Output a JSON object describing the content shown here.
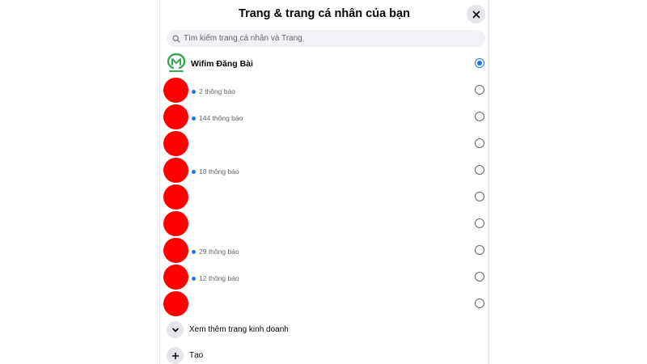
{
  "dialog": {
    "title": "Trang & trang cá nhân của bạn"
  },
  "search": {
    "placeholder": "Tìm kiếm trang cá nhân và Trang"
  },
  "profiles": [
    {
      "name": "Wifim Đăng Bài",
      "notifications": "",
      "selected": true,
      "avatar": "wifim-logo"
    },
    {
      "name": "",
      "notifications": "2 thông báo",
      "selected": false,
      "avatar": "redacted"
    },
    {
      "name": "",
      "notifications": "144 thông báo",
      "selected": false,
      "avatar": "redacted"
    },
    {
      "name": "",
      "notifications": "",
      "selected": false,
      "avatar": "redacted"
    },
    {
      "name": "",
      "notifications": "18 thông báo",
      "selected": false,
      "avatar": "redacted"
    },
    {
      "name": "",
      "notifications": "",
      "selected": false,
      "avatar": "redacted"
    },
    {
      "name": "",
      "notifications": "",
      "selected": false,
      "avatar": "redacted"
    },
    {
      "name": "",
      "notifications": "29 thông báo",
      "selected": false,
      "avatar": "redacted"
    },
    {
      "name": "",
      "notifications": "12 thông báo",
      "selected": false,
      "avatar": "redacted"
    },
    {
      "name": "",
      "notifications": "",
      "selected": false,
      "avatar": "redacted"
    }
  ],
  "actions": {
    "see_more_label": "Xem thêm trang kinh doanh",
    "create_label": "Tạo"
  },
  "colors": {
    "accent": "#1b74e4",
    "notification_dot": "#1877f2",
    "redacted_avatar": "#ff0000",
    "logo_green": "#3aa655"
  }
}
